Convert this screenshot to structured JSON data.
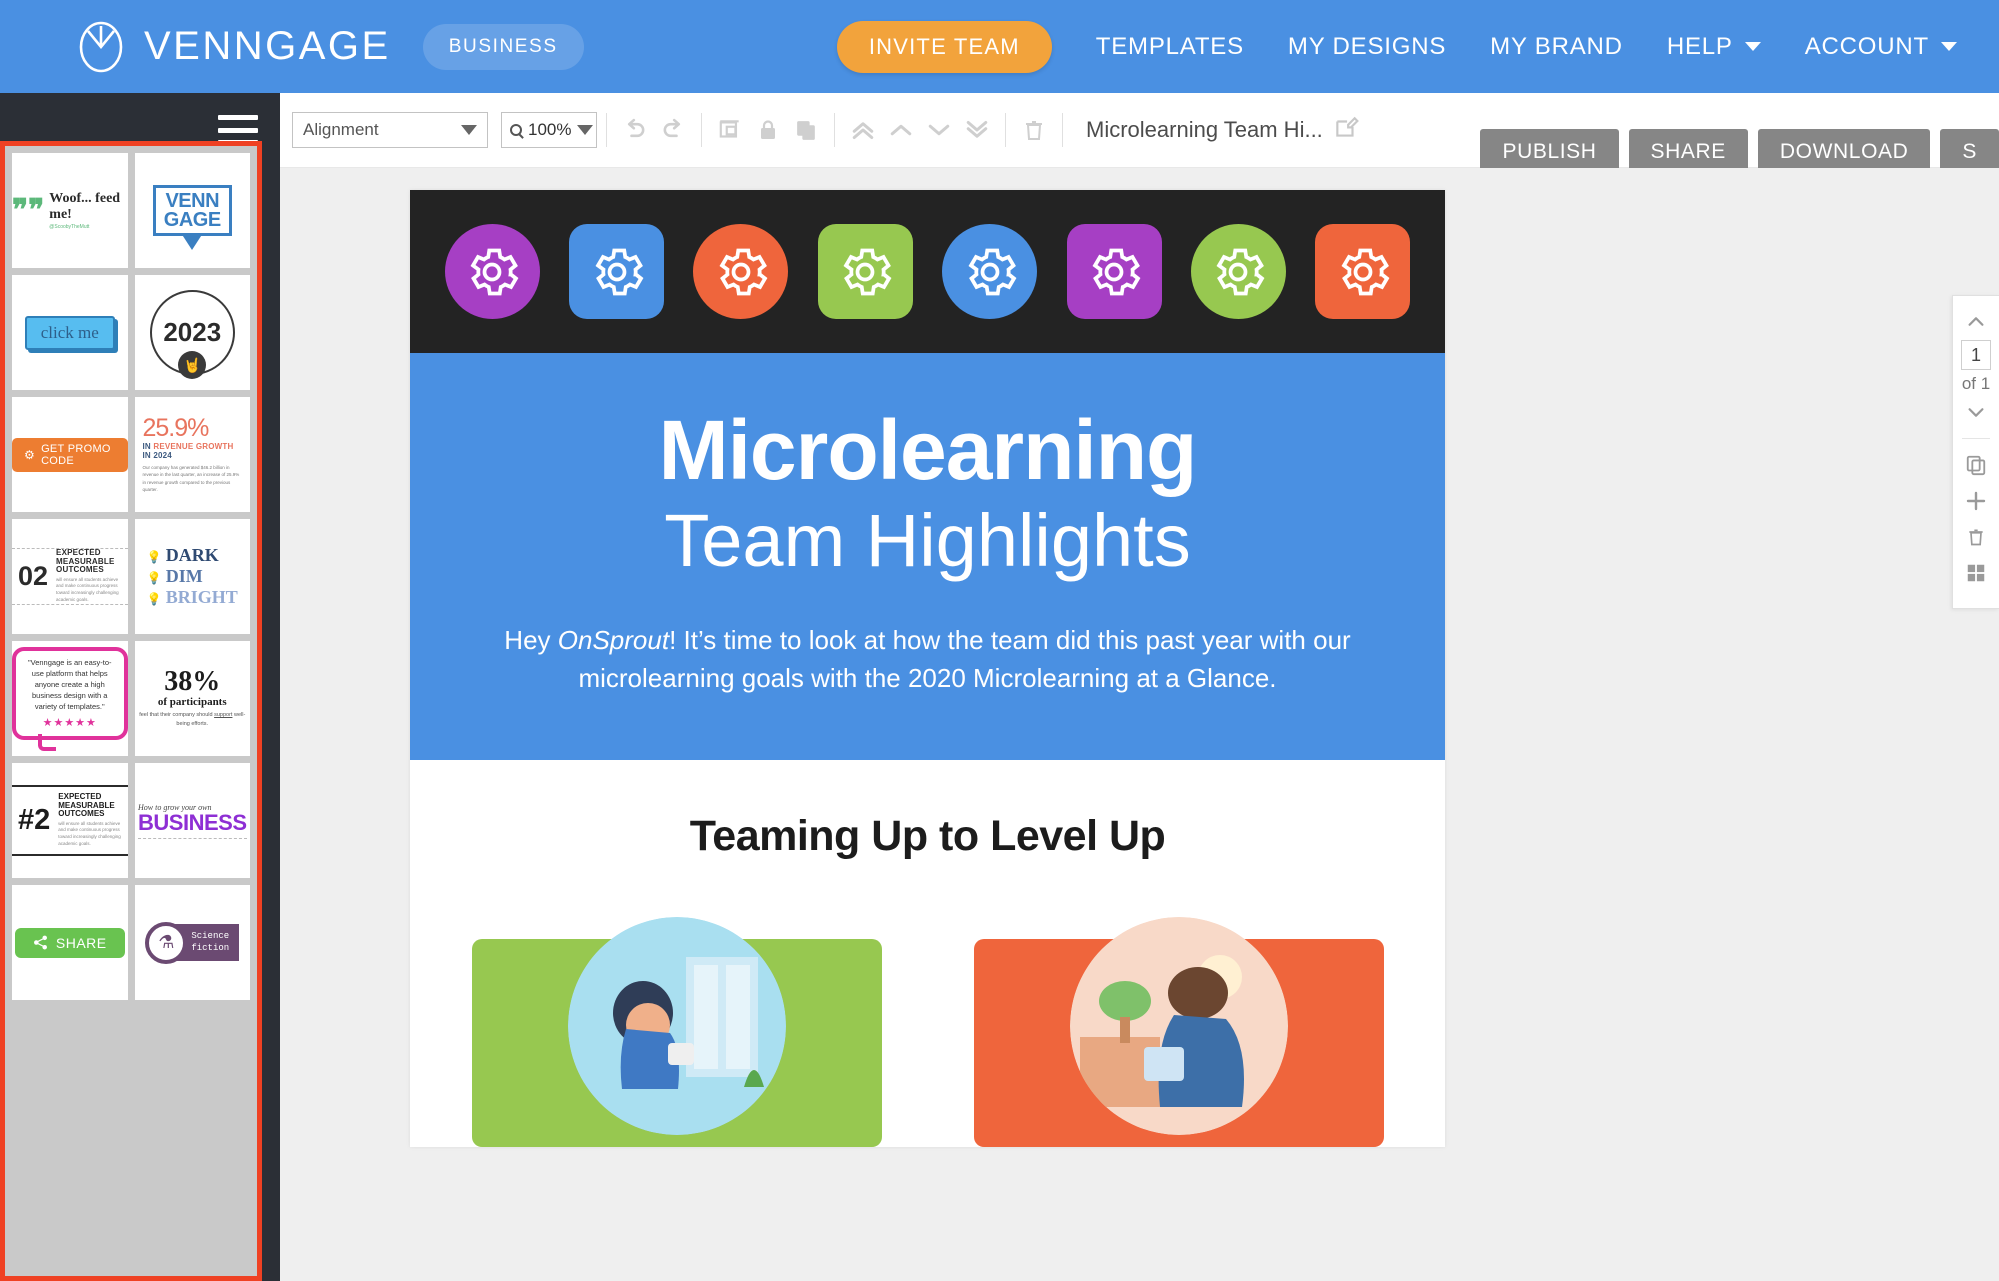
{
  "topnav": {
    "brand_name": "VENNGAGE",
    "brand_badge": "BUSINESS",
    "invite_label": "INVITE TEAM",
    "links": [
      {
        "label": "TEMPLATES",
        "has_caret": false
      },
      {
        "label": "MY DESIGNS",
        "has_caret": false
      },
      {
        "label": "MY BRAND",
        "has_caret": false
      },
      {
        "label": "HELP",
        "has_caret": true
      },
      {
        "label": "ACCOUNT",
        "has_caret": true
      }
    ]
  },
  "toolbar": {
    "alignment_label": "Alignment",
    "zoom_value": "100%",
    "doc_title": "Microlearning Team Hi...",
    "icons": [
      "undo-icon",
      "redo-icon",
      "group-icon",
      "lock-icon",
      "duplicate-icon",
      "bring-to-front-icon",
      "bring-forward-icon",
      "send-backward-icon",
      "send-to-back-icon",
      "delete-icon"
    ],
    "actions": [
      {
        "label": "PUBLISH"
      },
      {
        "label": "SHARE"
      },
      {
        "label": "DOWNLOAD"
      },
      {
        "label": "S"
      }
    ]
  },
  "sidebar": {
    "menu_icon": "hamburger-icon",
    "selection_border_color": "#ef4123",
    "thumbnails": [
      {
        "id": "quote-woof",
        "title": "Woof... feed me!",
        "handle": "@ScoobyTheMutt",
        "quote_mark": "❝❝"
      },
      {
        "id": "venngage-pin",
        "line1": "VENN",
        "line2": "GAGE"
      },
      {
        "id": "click-me",
        "label": "click me"
      },
      {
        "id": "year-2023",
        "year": "2023",
        "badge_icon": "rock-hand-icon"
      },
      {
        "id": "promo-code",
        "label": "GET PROMO CODE",
        "icon": "gear-icon"
      },
      {
        "id": "revenue-stat",
        "big": "25.9%",
        "sub_lead": "IN",
        "sub_mid": "REVENUE GROWTH",
        "sub_tail": "IN 2024",
        "body": "Our company has generated $46.2 billion in revenue in the last quarter, an increase of 25.9% in revenue growth compared to the previous quarter."
      },
      {
        "id": "outcome-02",
        "num": "02",
        "label": "EXPECTED MEASURABLE OUTCOMES",
        "body": "will ensure all students achieve and make continuous progress toward increasingly challenging academic goals."
      },
      {
        "id": "dark-dim-bright",
        "r1": "DARK",
        "r2": "DIM",
        "r3": "BRIGHT",
        "bullet": "bulb-icon"
      },
      {
        "id": "testimonial",
        "text": "\"Venngage is an easy-to-use platform that helps anyone create a high business design with a variety of templates.\"",
        "brand": "Venngage",
        "stars": "★★★★★"
      },
      {
        "id": "stat-38",
        "big": "38%",
        "md": "of participants",
        "sm_a": "feel that their company should ",
        "sm_u": "support",
        "sm_b": " well-being efforts."
      },
      {
        "id": "outcome-h2",
        "num": "#2",
        "label": "EXPECTED MEASURABLE OUTCOMES",
        "body": "will ensure all students achieve and make continuous progress toward increasingly challenging academic goals."
      },
      {
        "id": "grow-business",
        "script": "How to grow your own",
        "word": "BUSINESS"
      },
      {
        "id": "share-button",
        "label": "SHARE",
        "icon": "share-icon"
      },
      {
        "id": "science-fiction",
        "line1": "Science",
        "line2": "fiction",
        "icon": "dna-icon"
      }
    ]
  },
  "canvas": {
    "gear_strip": {
      "background": "#232323",
      "gears": [
        {
          "color": "#a63fc4",
          "shape": "circle"
        },
        {
          "color": "#4a90e2",
          "shape": "square"
        },
        {
          "color": "#ef653c",
          "shape": "circle"
        },
        {
          "color": "#97c850",
          "shape": "square"
        },
        {
          "color": "#4a90e2",
          "shape": "circle"
        },
        {
          "color": "#a63fc4",
          "shape": "square"
        },
        {
          "color": "#97c850",
          "shape": "circle"
        },
        {
          "color": "#ef653c",
          "shape": "square"
        }
      ],
      "icon": "gear-icon"
    },
    "hero": {
      "background": "#4a90e2",
      "title_bold": "Microlearning",
      "title_light": "Team Highlights",
      "body_a": "Hey ",
      "body_em": "OnSprout",
      "body_b": "! It’s time to look at how the team did this past year with our microlearning goals with the 2020 Microlearning at a Glance."
    },
    "section": {
      "heading": "Teaming Up to Level Up",
      "illustrations": [
        {
          "id": "illustration-left",
          "plate_color": "#97c850"
        },
        {
          "id": "illustration-right",
          "plate_color": "#ef653c"
        }
      ]
    }
  },
  "right_rail": {
    "up_icon": "chevron-up-icon",
    "page_number": "1",
    "page_of": "of 1",
    "down_icon": "chevron-down-icon",
    "duplicate_icon": "duplicate-page-icon",
    "add_icon": "add-page-icon",
    "delete_icon": "delete-page-icon",
    "grid_icon": "grid-view-icon"
  }
}
